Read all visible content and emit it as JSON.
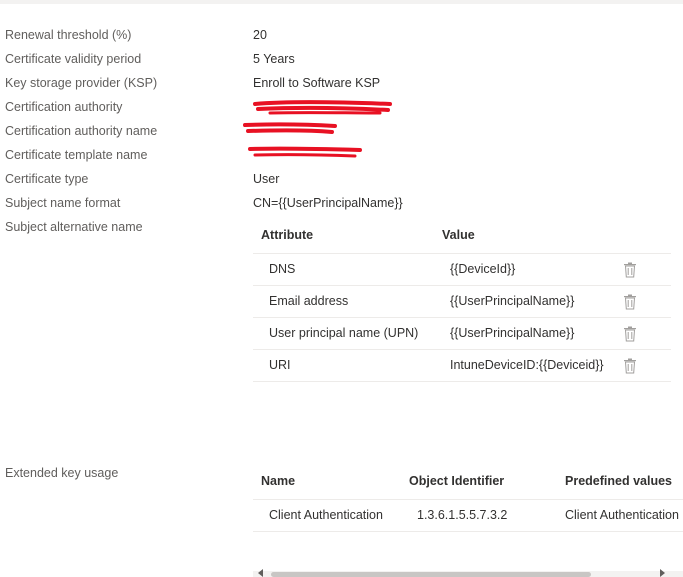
{
  "properties": [
    {
      "label": "Renewal threshold (%)",
      "value": "20"
    },
    {
      "label": "Certificate validity period",
      "value": "5 Years"
    },
    {
      "label": "Key storage provider (KSP)",
      "value": "Enroll to Software KSP"
    },
    {
      "label": "Certification authority",
      "value": ""
    },
    {
      "label": "Certification authority name",
      "value": ""
    },
    {
      "label": "Certificate template name",
      "value": ""
    },
    {
      "label": "Certificate type",
      "value": "User"
    },
    {
      "label": "Subject name format",
      "value": "CN={{UserPrincipalName}}"
    },
    {
      "label": "Subject alternative name",
      "value": ""
    }
  ],
  "san_table": {
    "headers": {
      "attribute": "Attribute",
      "value": "Value"
    },
    "rows": [
      {
        "attribute": "DNS",
        "value": "{{DeviceId}}"
      },
      {
        "attribute": "Email address",
        "value": "{{UserPrincipalName}}"
      },
      {
        "attribute": "User principal name (UPN)",
        "value": "{{UserPrincipalName}}"
      },
      {
        "attribute": "URI",
        "value": "IntuneDeviceID:{{Deviceid}}"
      }
    ]
  },
  "extended_key_usage": {
    "label": "Extended key usage",
    "headers": {
      "name": "Name",
      "oid": "Object Identifier",
      "predefined": "Predefined values"
    },
    "rows": [
      {
        "name": "Client Authentication",
        "oid": "1.3.6.1.5.5.7.3.2",
        "predefined": "Client Authentication"
      }
    ]
  },
  "colors": {
    "label": "#605e5c",
    "text": "#323130",
    "divider": "#edebe9",
    "redaction": "#e81123",
    "icon": "#a19f9d"
  }
}
